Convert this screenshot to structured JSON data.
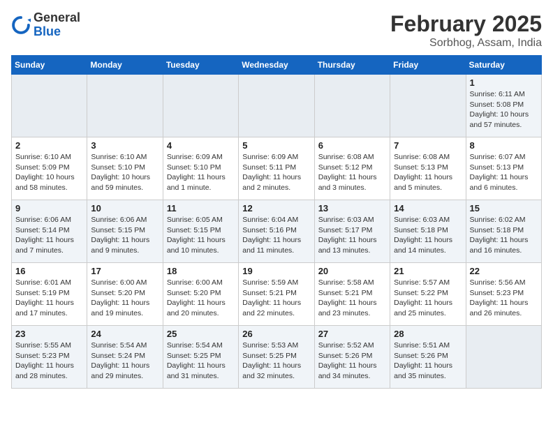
{
  "header": {
    "logo_general": "General",
    "logo_blue": "Blue",
    "month": "February 2025",
    "location": "Sorbhog, Assam, India"
  },
  "weekdays": [
    "Sunday",
    "Monday",
    "Tuesday",
    "Wednesday",
    "Thursday",
    "Friday",
    "Saturday"
  ],
  "weeks": [
    [
      {
        "day": "",
        "info": ""
      },
      {
        "day": "",
        "info": ""
      },
      {
        "day": "",
        "info": ""
      },
      {
        "day": "",
        "info": ""
      },
      {
        "day": "",
        "info": ""
      },
      {
        "day": "",
        "info": ""
      },
      {
        "day": "1",
        "info": "Sunrise: 6:11 AM\nSunset: 5:08 PM\nDaylight: 10 hours\nand 57 minutes."
      }
    ],
    [
      {
        "day": "2",
        "info": "Sunrise: 6:10 AM\nSunset: 5:09 PM\nDaylight: 10 hours\nand 58 minutes."
      },
      {
        "day": "3",
        "info": "Sunrise: 6:10 AM\nSunset: 5:10 PM\nDaylight: 10 hours\nand 59 minutes."
      },
      {
        "day": "4",
        "info": "Sunrise: 6:09 AM\nSunset: 5:10 PM\nDaylight: 11 hours\nand 1 minute."
      },
      {
        "day": "5",
        "info": "Sunrise: 6:09 AM\nSunset: 5:11 PM\nDaylight: 11 hours\nand 2 minutes."
      },
      {
        "day": "6",
        "info": "Sunrise: 6:08 AM\nSunset: 5:12 PM\nDaylight: 11 hours\nand 3 minutes."
      },
      {
        "day": "7",
        "info": "Sunrise: 6:08 AM\nSunset: 5:13 PM\nDaylight: 11 hours\nand 5 minutes."
      },
      {
        "day": "8",
        "info": "Sunrise: 6:07 AM\nSunset: 5:13 PM\nDaylight: 11 hours\nand 6 minutes."
      }
    ],
    [
      {
        "day": "9",
        "info": "Sunrise: 6:06 AM\nSunset: 5:14 PM\nDaylight: 11 hours\nand 7 minutes."
      },
      {
        "day": "10",
        "info": "Sunrise: 6:06 AM\nSunset: 5:15 PM\nDaylight: 11 hours\nand 9 minutes."
      },
      {
        "day": "11",
        "info": "Sunrise: 6:05 AM\nSunset: 5:15 PM\nDaylight: 11 hours\nand 10 minutes."
      },
      {
        "day": "12",
        "info": "Sunrise: 6:04 AM\nSunset: 5:16 PM\nDaylight: 11 hours\nand 11 minutes."
      },
      {
        "day": "13",
        "info": "Sunrise: 6:03 AM\nSunset: 5:17 PM\nDaylight: 11 hours\nand 13 minutes."
      },
      {
        "day": "14",
        "info": "Sunrise: 6:03 AM\nSunset: 5:18 PM\nDaylight: 11 hours\nand 14 minutes."
      },
      {
        "day": "15",
        "info": "Sunrise: 6:02 AM\nSunset: 5:18 PM\nDaylight: 11 hours\nand 16 minutes."
      }
    ],
    [
      {
        "day": "16",
        "info": "Sunrise: 6:01 AM\nSunset: 5:19 PM\nDaylight: 11 hours\nand 17 minutes."
      },
      {
        "day": "17",
        "info": "Sunrise: 6:00 AM\nSunset: 5:20 PM\nDaylight: 11 hours\nand 19 minutes."
      },
      {
        "day": "18",
        "info": "Sunrise: 6:00 AM\nSunset: 5:20 PM\nDaylight: 11 hours\nand 20 minutes."
      },
      {
        "day": "19",
        "info": "Sunrise: 5:59 AM\nSunset: 5:21 PM\nDaylight: 11 hours\nand 22 minutes."
      },
      {
        "day": "20",
        "info": "Sunrise: 5:58 AM\nSunset: 5:21 PM\nDaylight: 11 hours\nand 23 minutes."
      },
      {
        "day": "21",
        "info": "Sunrise: 5:57 AM\nSunset: 5:22 PM\nDaylight: 11 hours\nand 25 minutes."
      },
      {
        "day": "22",
        "info": "Sunrise: 5:56 AM\nSunset: 5:23 PM\nDaylight: 11 hours\nand 26 minutes."
      }
    ],
    [
      {
        "day": "23",
        "info": "Sunrise: 5:55 AM\nSunset: 5:23 PM\nDaylight: 11 hours\nand 28 minutes."
      },
      {
        "day": "24",
        "info": "Sunrise: 5:54 AM\nSunset: 5:24 PM\nDaylight: 11 hours\nand 29 minutes."
      },
      {
        "day": "25",
        "info": "Sunrise: 5:54 AM\nSunset: 5:25 PM\nDaylight: 11 hours\nand 31 minutes."
      },
      {
        "day": "26",
        "info": "Sunrise: 5:53 AM\nSunset: 5:25 PM\nDaylight: 11 hours\nand 32 minutes."
      },
      {
        "day": "27",
        "info": "Sunrise: 5:52 AM\nSunset: 5:26 PM\nDaylight: 11 hours\nand 34 minutes."
      },
      {
        "day": "28",
        "info": "Sunrise: 5:51 AM\nSunset: 5:26 PM\nDaylight: 11 hours\nand 35 minutes."
      },
      {
        "day": "",
        "info": ""
      }
    ]
  ]
}
